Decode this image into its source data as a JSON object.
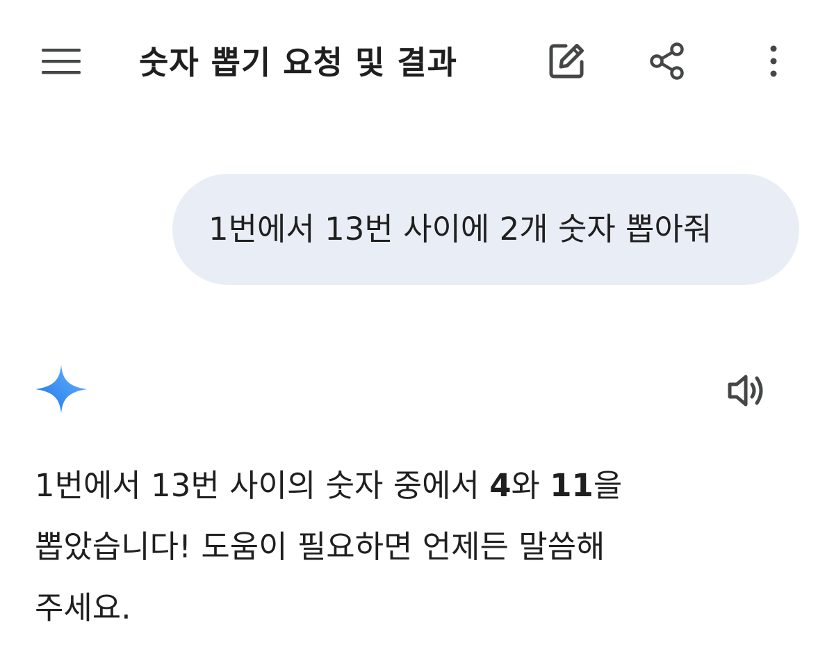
{
  "header": {
    "title": "숫자 뽑기 요청 및 결과",
    "icons": {
      "menu": "menu-icon",
      "edit": "edit-icon",
      "share": "share-icon",
      "more": "more-vert-icon"
    }
  },
  "conversation": {
    "user_message": "1번에서 13번 사이에 2개 숫자 뽑아줘",
    "assistant": {
      "avatar_icon": "gemini-sparkle-icon",
      "speaker_icon": "speaker-icon",
      "line1_part1": "1번에서 13번 사이의 숫자 중에서 ",
      "number1": "4",
      "line1_part2": "와 ",
      "number2": "11",
      "line1_part3": "을",
      "line2": "뽑았습니다! 도움이 필요하면 언제든 말씀해",
      "line3": "주세요."
    }
  },
  "colors": {
    "background": "#ffffff",
    "text": "#1f1f1f",
    "user_bubble": "#e9eef6",
    "icon": "#444746",
    "sparkle_start": "#1a73e8",
    "sparkle_end": "#6ab4ff"
  }
}
